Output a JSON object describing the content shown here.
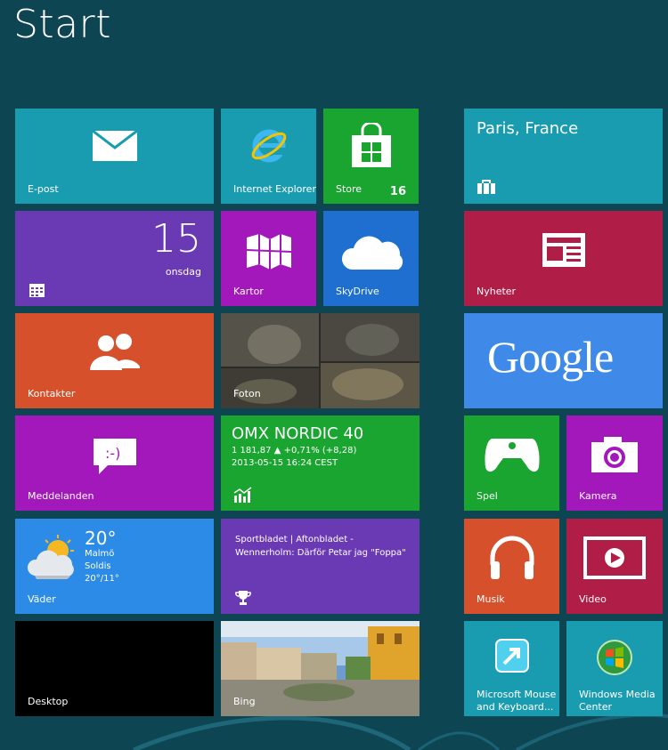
{
  "screen": {
    "title": "Start",
    "background_color": "#0d4552"
  },
  "tiles": {
    "mail": {
      "label": "E-post",
      "color": "#1a9cb0"
    },
    "ie": {
      "label": "Internet Explorer",
      "color": "#1a9cb0"
    },
    "store": {
      "label": "Store",
      "badge": "16",
      "color": "#1aa530"
    },
    "weather_city": {
      "city": "Paris, France",
      "color": "#1a9cb0"
    },
    "calendar": {
      "day": "15",
      "weekday": "onsdag",
      "color": "#6a3ab5"
    },
    "maps": {
      "label": "Kartor",
      "color": "#a218ba"
    },
    "skydrive": {
      "label": "SkyDrive",
      "color": "#1e6fd0"
    },
    "news": {
      "label": "Nyheter",
      "color": "#b01e48"
    },
    "people": {
      "label": "Kontakter",
      "color": "#d6512b"
    },
    "photos": {
      "label": "Foton"
    },
    "google": {
      "brand": "Google",
      "color": "#3f8ae8"
    },
    "messaging": {
      "label": "Meddelanden",
      "color": "#a218ba"
    },
    "finance": {
      "title": "OMX NORDIC 40",
      "line1": "1 181,87 ▲ +0,71% (+8,28)",
      "line2": "2013-05-15 16:24 CEST",
      "color": "#1aa530"
    },
    "games": {
      "label": "Spel",
      "color": "#1aa530"
    },
    "camera": {
      "label": "Kamera",
      "color": "#a218ba"
    },
    "weather": {
      "label": "Väder",
      "temp": "20°",
      "city": "Malmö",
      "condition": "Soldis",
      "range": "20°/11°",
      "color": "#2b8be6"
    },
    "sport": {
      "line1": "Sportbladet | Aftonbladet  -",
      "line2": "Wennerholm: Därför Petar jag \"Foppa\"",
      "color": "#6a3ab5"
    },
    "music": {
      "label": "Musik",
      "color": "#d6512b"
    },
    "video": {
      "label": "Video",
      "color": "#b01e48"
    },
    "desktop": {
      "label": "Desktop",
      "color": "#000000"
    },
    "bing": {
      "label": "Bing"
    },
    "mouse_kb": {
      "line1": "Microsoft Mouse",
      "line2": "and Keyboard...",
      "color": "#1a9cb0"
    },
    "wmc": {
      "line1": "Windows Media",
      "line2": "Center",
      "color": "#1a9cb0"
    }
  }
}
